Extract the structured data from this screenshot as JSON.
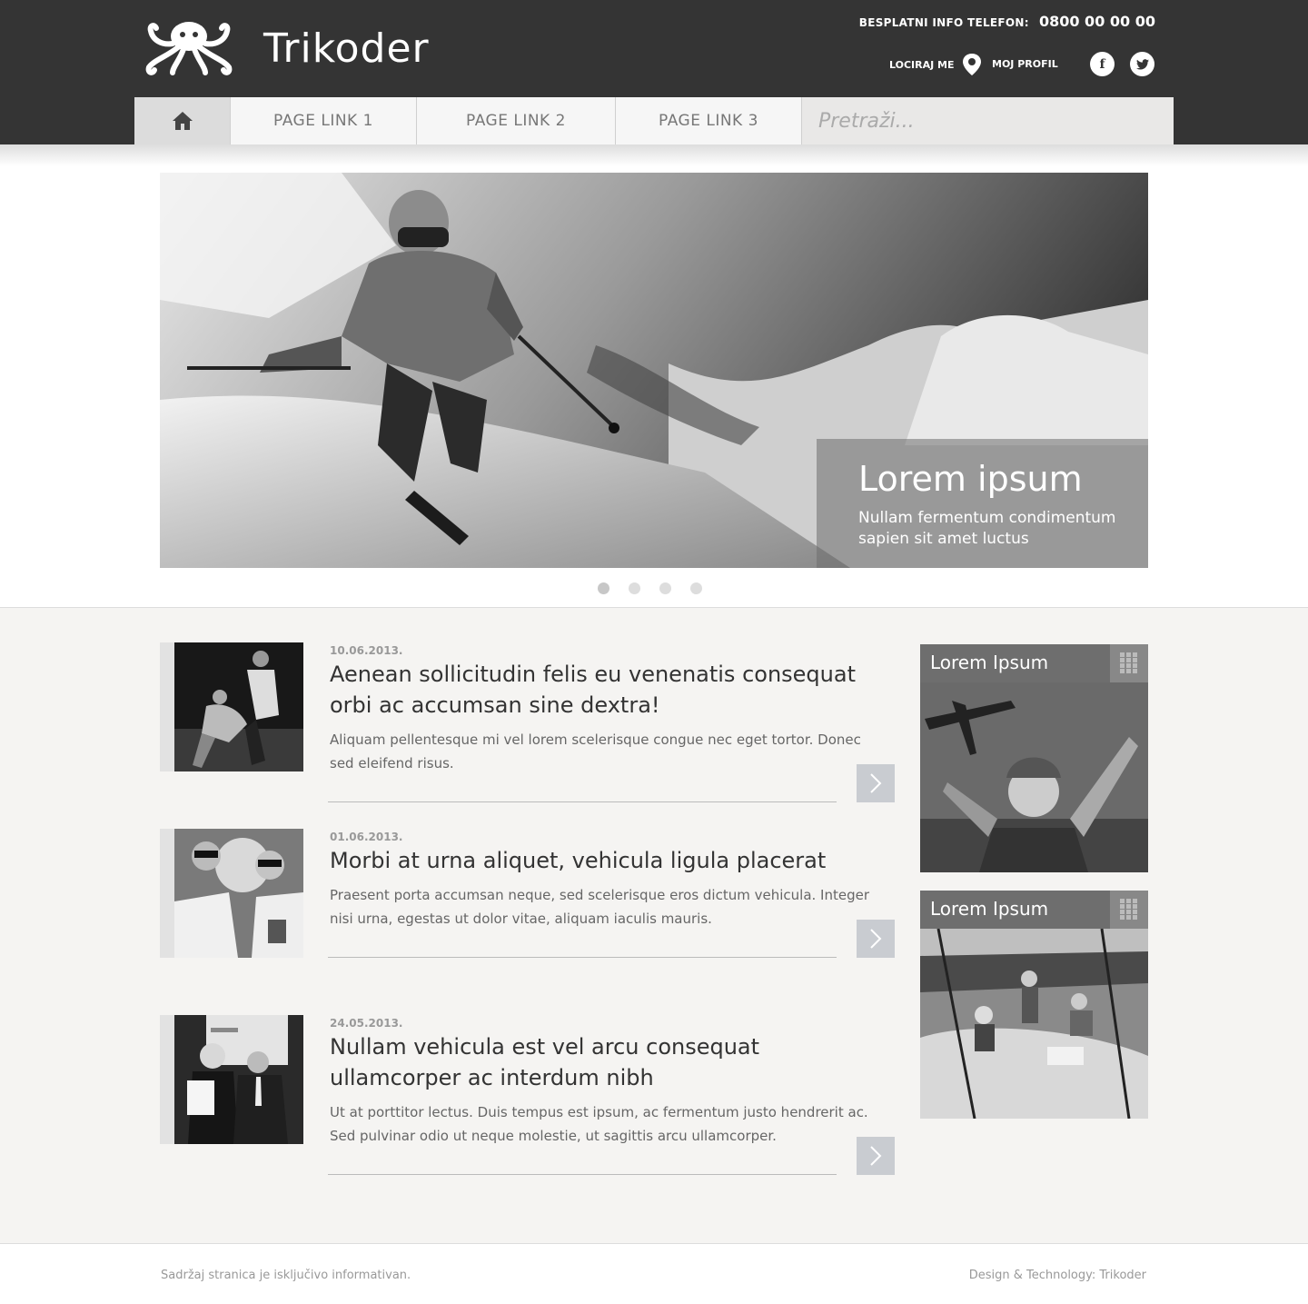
{
  "header": {
    "brand": "Trikoder",
    "phone_label": "BESPLATNI INFO TELEFON:",
    "phone_number": "0800 00 00 00",
    "locate_label": "LOCIRAJ ME",
    "profile_label": "MOJ PROFIL",
    "social": [
      "f",
      "t"
    ]
  },
  "nav": {
    "links": [
      "PAGE LINK 1",
      "PAGE LINK 2",
      "PAGE LINK 3"
    ],
    "search_placeholder": "Pretraži..."
  },
  "hero": {
    "title": "Lorem ipsum",
    "subtitle": "Nullam fermentum condimentum sapien sit amet luctus",
    "active_slide": 1,
    "slide_count": 4
  },
  "news": [
    {
      "date": "10.06.2013.",
      "title": "Aenean sollicitudin felis eu venenatis consequat orbi ac accumsan sine dextra!",
      "text": "Aliquam pellentesque mi vel lorem scelerisque congue nec eget tortor. Donec sed eleifend risus."
    },
    {
      "date": "01.06.2013.",
      "title": "Morbi at urna aliquet, vehicula ligula placerat",
      "text": "Praesent porta accumsan neque, sed scelerisque eros dictum vehicula. Integer nisi urna, egestas ut dolor vitae, aliquam iaculis mauris."
    },
    {
      "date": "24.05.2013.",
      "title": "Nullam vehicula est vel arcu consequat ullamcorper ac interdum nibh",
      "text": "Ut at porttitor lectus. Duis tempus est ipsum, ac fermentum justo hendrerit ac. Sed pulvinar odio ut neque molestie, ut sagittis arcu ullamcorper."
    }
  ],
  "widgets": [
    {
      "title": "Lorem Ipsum"
    },
    {
      "title": "Lorem Ipsum"
    }
  ],
  "footer": {
    "left": "Sadržaj stranica je isključivo informativan.",
    "right": "Design & Technology: Trikoder"
  },
  "colors": {
    "header_bg": "#343434",
    "page_bg": "#f5f4f2",
    "more_button": "#c9ccd1"
  }
}
